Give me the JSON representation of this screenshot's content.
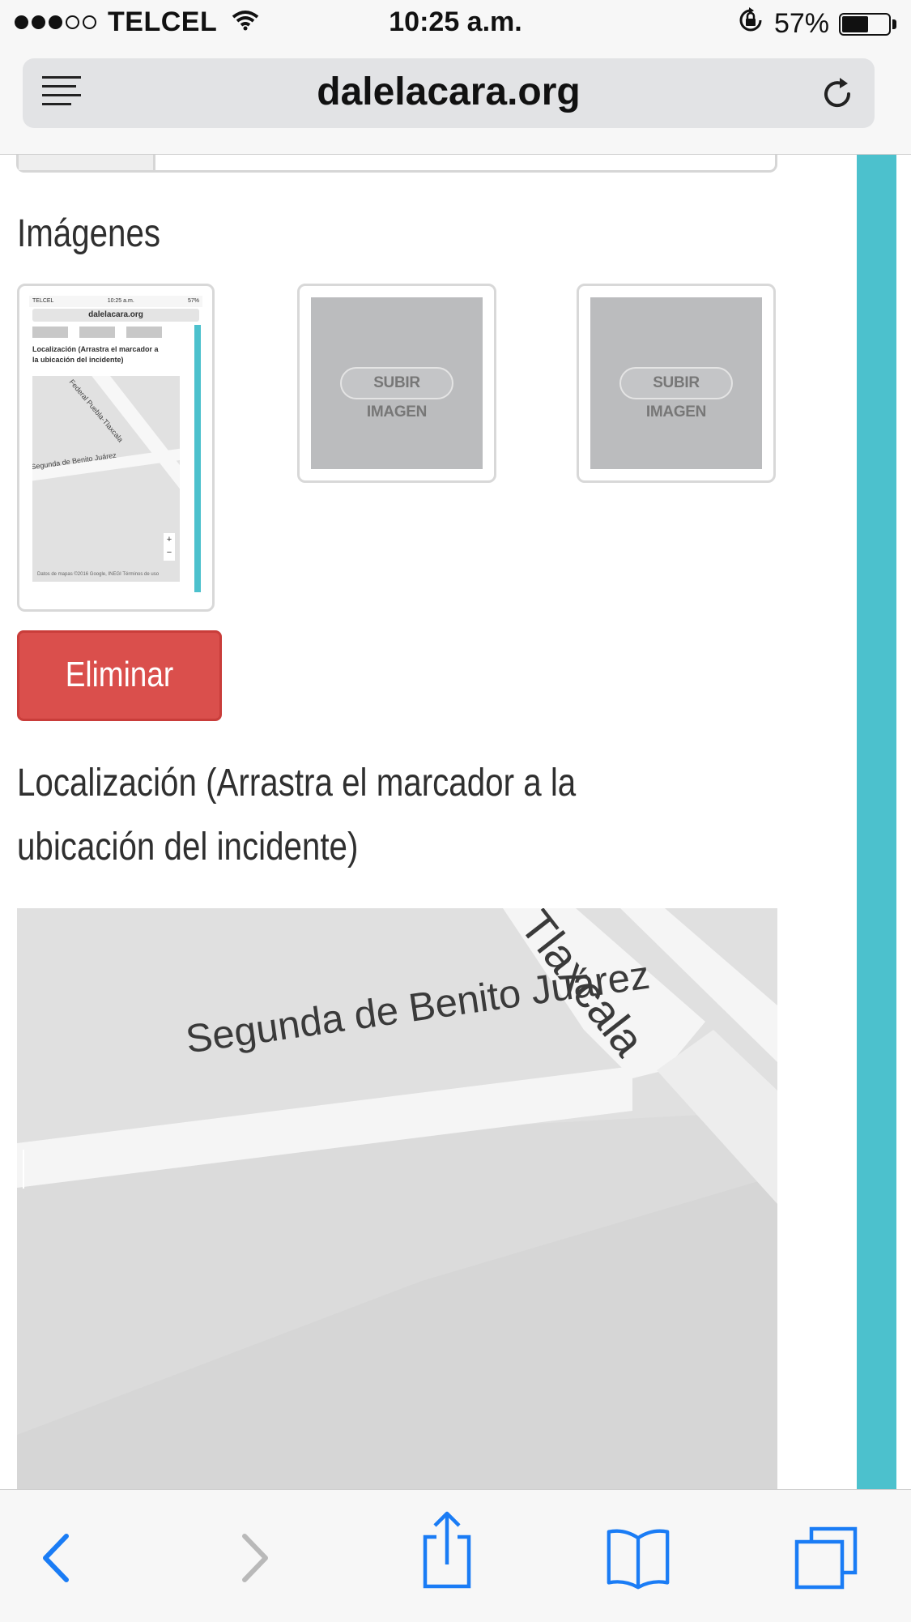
{
  "status_bar": {
    "carrier": "TELCEL",
    "time": "10:25 a.m.",
    "battery_percent": "57%",
    "battery_level": 0.57,
    "signal_bars_filled": 3,
    "signal_bars_total": 5
  },
  "browser": {
    "url": "dalelacara.org",
    "reader_icon": "reader-list-icon",
    "reload_icon": "reload-icon"
  },
  "images_section": {
    "title": "Imágenes",
    "upload_label": "SUBIR IMAGEN",
    "delete_label": "Eliminar",
    "delete_color": "#da4f4c"
  },
  "thumbnail_preview": {
    "carrier": "TELCEL",
    "time": "10:25 a.m.",
    "battery": "57%",
    "url": "dalelacara.org",
    "caption": "Localización (Arrastra el marcador a la ubicación del incidente)",
    "street_1": "Segunda de Benito Juárez",
    "street_2": "Federal Puebla-Tlaxcala",
    "footer": "Datos de mapas ©2016 Google, INEGI   Términos de uso"
  },
  "location_section": {
    "title_line1": "Localización (Arrastra el marcador a la",
    "title_line2": "ubicación del incidente)"
  },
  "map": {
    "street_juarez": "Segunda de Benito Juárez",
    "street_tlaxcala": "Tlaxcala"
  },
  "colors": {
    "accent_teal": "#4cc1cd",
    "ios_blue": "#1a7cf5"
  }
}
